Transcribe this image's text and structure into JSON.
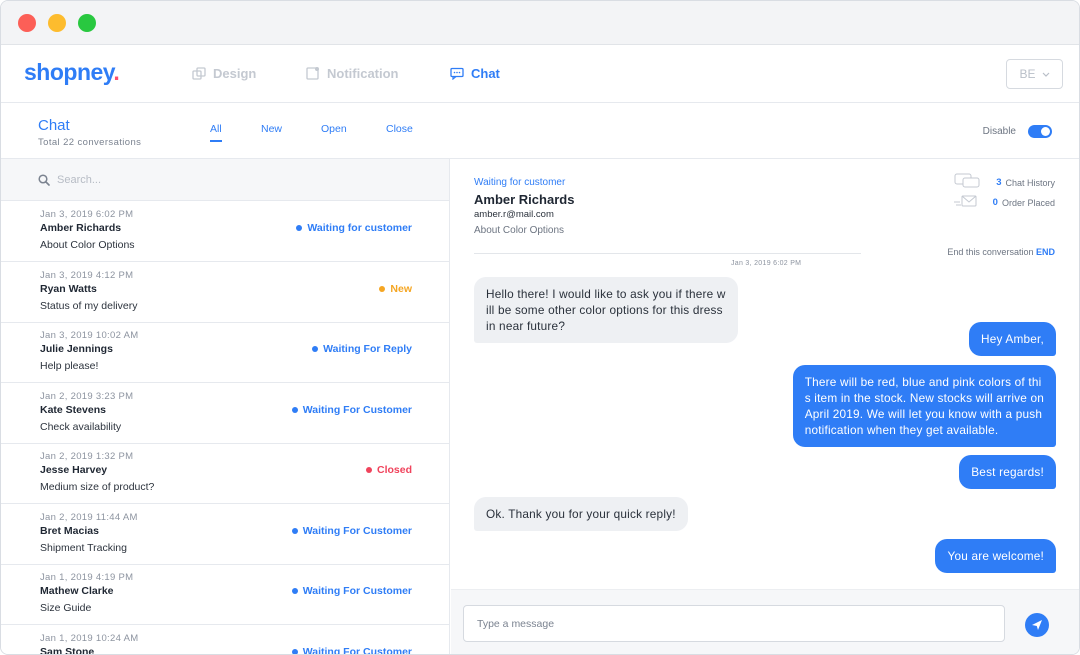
{
  "app": {
    "logo": "shopney",
    "logo_dot": ".",
    "nav": [
      {
        "label": "Design",
        "icon": "design-icon",
        "active": false
      },
      {
        "label": "Notification",
        "icon": "notification-icon",
        "active": false
      },
      {
        "label": "Chat",
        "icon": "chat-icon",
        "active": true
      }
    ],
    "language": "BE"
  },
  "chat_header": {
    "title": "Chat",
    "subtitle": "Total 22 conversations",
    "filters": [
      {
        "label": "All",
        "active": true
      },
      {
        "label": "New",
        "active": false
      },
      {
        "label": "Open",
        "active": false
      },
      {
        "label": "Close",
        "active": false
      }
    ],
    "disable_label": "Disable",
    "toggle_on": true
  },
  "search": {
    "placeholder": "Search..."
  },
  "conversations": [
    {
      "date": "Jan 3, 2019 6:02 PM",
      "name": "Amber Richards",
      "subject": "About Color Options",
      "status": "Waiting for customer",
      "status_color": "#2f7df6"
    },
    {
      "date": "Jan 3, 2019 4:12 PM",
      "name": "Ryan Watts",
      "subject": "Status of my delivery",
      "status": "New",
      "status_color": "#f5a623"
    },
    {
      "date": "Jan 3, 2019 10:02 AM",
      "name": "Julie Jennings",
      "subject": "Help please!",
      "status": "Waiting For Reply",
      "status_color": "#2f7df6"
    },
    {
      "date": "Jan 2, 2019 3:23 PM",
      "name": "Kate Stevens",
      "subject": "Check availability",
      "status": "Waiting For Customer",
      "status_color": "#2f7df6"
    },
    {
      "date": "Jan 2, 2019 1:32 PM",
      "name": "Jesse Harvey",
      "subject": "Medium size of product?",
      "status": "Closed",
      "status_color": "#f0435c"
    },
    {
      "date": "Jan 2, 2019 11:44 AM",
      "name": "Bret Macias",
      "subject": "Shipment Tracking",
      "status": "Waiting For Customer",
      "status_color": "#2f7df6"
    },
    {
      "date": "Jan 1, 2019 4:19 PM",
      "name": "Mathew Clarke",
      "subject": "Size Guide",
      "status": "Waiting For Customer",
      "status_color": "#2f7df6"
    },
    {
      "date": "Jan 1, 2019 10:24 AM",
      "name": "Sam Stone",
      "subject": "",
      "status": "Waiting For Customer",
      "status_color": "#2f7df6"
    }
  ],
  "detail": {
    "status": "Waiting for customer",
    "name": "Amber Richards",
    "email": "amber.r@mail.com",
    "subject": "About Color Options",
    "chat_history_count": "3",
    "chat_history_label": "Chat History",
    "orders_count": "0",
    "orders_label": "Order Placed",
    "end_label": "End this conversation",
    "end_action": "END",
    "divider_date": "Jan 3, 2019 6:02 PM"
  },
  "messages": [
    {
      "from": "customer",
      "lines": [
        "Hello there! I would like to ask you if there w",
        "ill be some other color options for this dress",
        "in near future?"
      ]
    },
    {
      "from": "agent",
      "lines": [
        "Hey Amber,"
      ]
    },
    {
      "from": "agent",
      "lines": [
        "There will be red, blue and pink colors of thi",
        "s item in the stock. New stocks will arrive on",
        "April 2019. We will let you know with a push",
        "notification when they get available."
      ]
    },
    {
      "from": "agent",
      "lines": [
        "Best regards!"
      ]
    },
    {
      "from": "customer",
      "lines": [
        "Ok. Thank you for your quick reply!"
      ]
    },
    {
      "from": "agent",
      "lines": [
        "You are welcome!"
      ]
    }
  ],
  "composer": {
    "placeholder": "Type a message"
  }
}
